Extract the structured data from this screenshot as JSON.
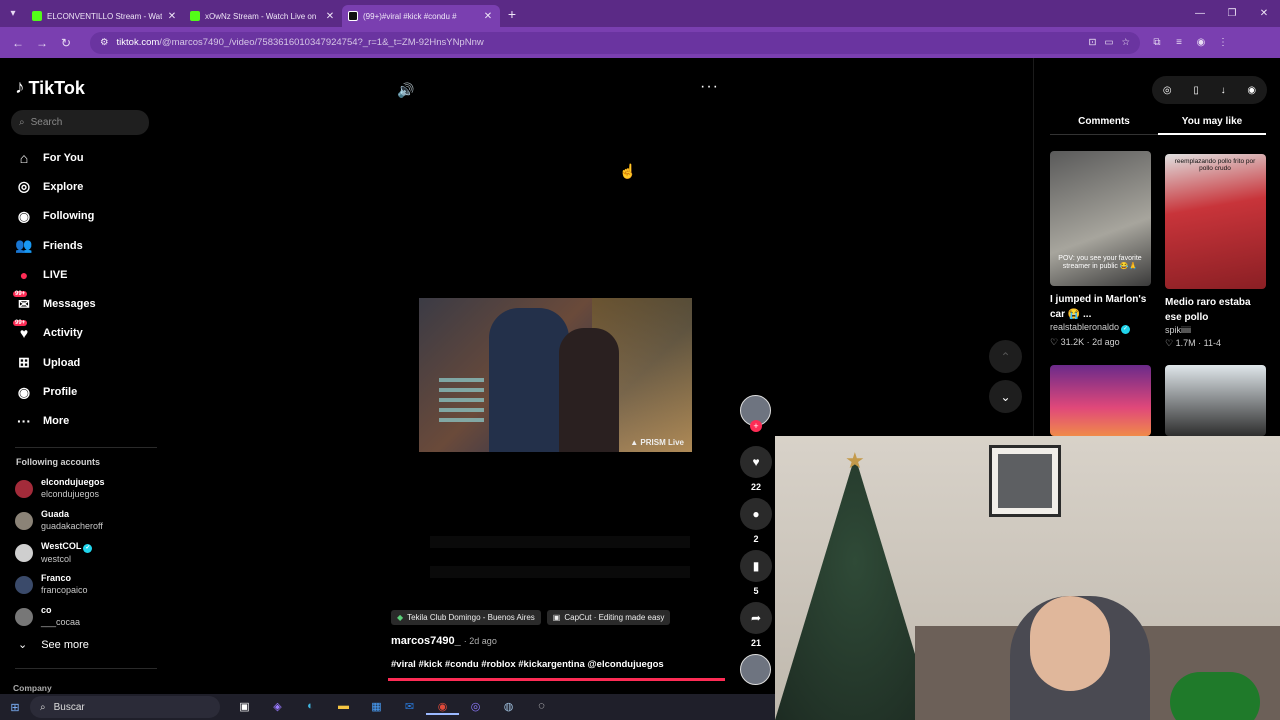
{
  "browser": {
    "tabs": [
      {
        "label": "ELCONVENTILLO Stream - Watc",
        "icon": "kick-icon"
      },
      {
        "label": "xOwNz Stream - Watch Live on",
        "icon": "kick-icon"
      },
      {
        "label": "(99+)#viral #kick #condu #",
        "icon": "tiktok-icon"
      }
    ],
    "url_domain": "tiktok.com",
    "url_path": "/@marcos7490_/video/7583616010347924754?_r=1&_t=ZM-92HnsYNpNnw"
  },
  "sidebar": {
    "logo": "TikTok",
    "search_placeholder": "Search",
    "items": [
      {
        "label": "For You",
        "icon": "home-icon",
        "glyph": "⌂"
      },
      {
        "label": "Explore",
        "icon": "compass-icon",
        "glyph": "◎"
      },
      {
        "label": "Following",
        "icon": "following-avatar-icon",
        "glyph": "◉"
      },
      {
        "label": "Friends",
        "icon": "friends-icon",
        "glyph": "👥"
      },
      {
        "label": "LIVE",
        "icon": "live-icon",
        "glyph": "●"
      },
      {
        "label": "Messages",
        "icon": "messages-icon",
        "glyph": "✉",
        "badge": "99+"
      },
      {
        "label": "Activity",
        "icon": "activity-icon",
        "glyph": "♥",
        "badge": "99+"
      },
      {
        "label": "Upload",
        "icon": "upload-icon",
        "glyph": "⊞"
      },
      {
        "label": "Profile",
        "icon": "profile-icon",
        "glyph": "◉"
      },
      {
        "label": "More",
        "icon": "more-icon",
        "glyph": "···"
      }
    ],
    "following_title": "Following accounts",
    "accounts": [
      {
        "name": "elcondujuegos",
        "username": "elcondujuegos"
      },
      {
        "name": "Guada",
        "username": "guadakacheroff"
      },
      {
        "name": "WestCOL",
        "username": "westcol",
        "verified": true
      },
      {
        "name": "Franco",
        "username": "francopaico"
      },
      {
        "name": "co",
        "username": "___cocaa"
      }
    ],
    "see_more": "See more",
    "company": "Company"
  },
  "video": {
    "watermark": "PRISM Live",
    "like_count": "22",
    "comment_count": "2",
    "save_count": "5",
    "share_count": "21",
    "chips": [
      {
        "label": "Tekila Club Domingo - Buenos Aires",
        "icon": "location-icon"
      },
      {
        "label": "CapCut · Editing made easy",
        "icon": "capcut-icon"
      }
    ],
    "author": "marcos7490_",
    "date": "· 2d ago",
    "caption": "#viral #kick #condu #roblox #kickargentina @elcondujuegos"
  },
  "right_panel": {
    "tabs": [
      "Comments",
      "You may like"
    ],
    "active_tab": "You may like",
    "cards": [
      {
        "title": "I jumped in Marlon's car 😭 ...",
        "user": "realstableronaldo",
        "verified": true,
        "likes": "31.2K",
        "date": "2d ago",
        "overlay": "POV: you see your favorite streamer in public 😂🙏",
        "bg": "#8a8a85"
      },
      {
        "title": "Medio raro estaba ese pollo",
        "user": "spikiiiii",
        "verified": false,
        "likes": "1.7M",
        "date": "11-4",
        "overlay": "reemplazando pollo frito por pollo crudo",
        "bg": "#c4343a"
      }
    ]
  },
  "taskbar": {
    "search": "Buscar"
  }
}
